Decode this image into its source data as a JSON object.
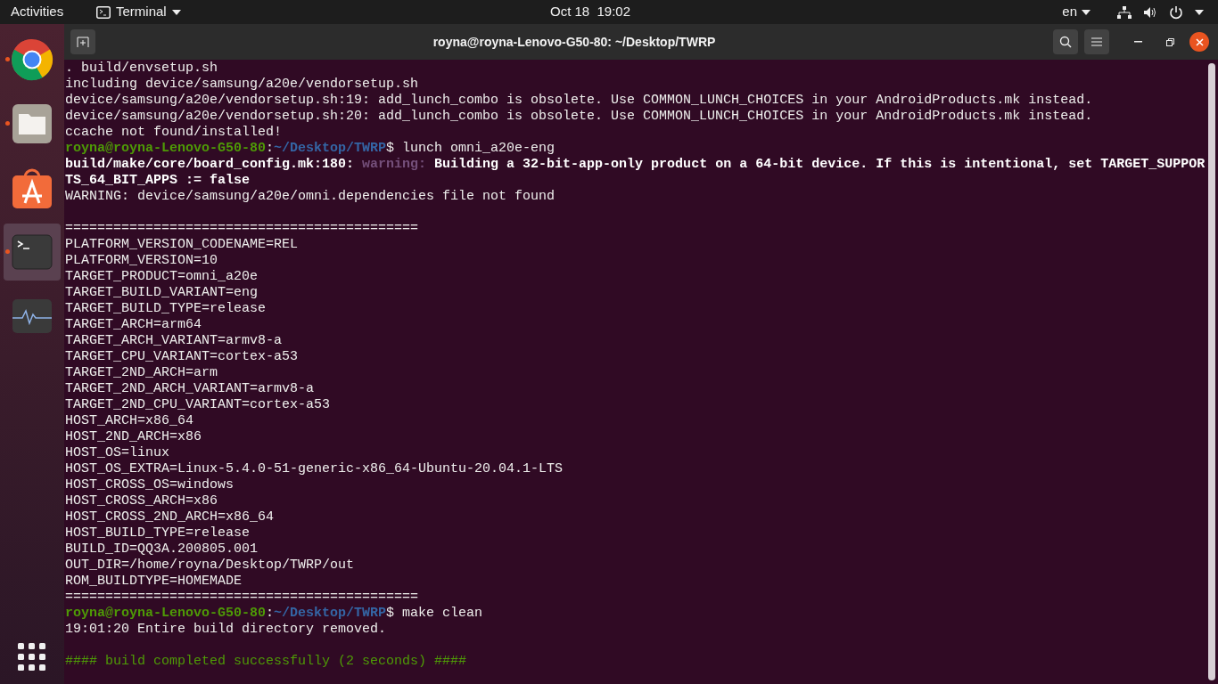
{
  "top_bar": {
    "activities": "Activities",
    "app_menu": "Terminal",
    "clock": "Oct 18  19:02",
    "language": "en"
  },
  "dock": {
    "items": [
      {
        "kind": "browser",
        "running": true,
        "selected": false
      },
      {
        "kind": "files",
        "running": true,
        "selected": false
      },
      {
        "kind": "store",
        "running": false,
        "selected": false
      },
      {
        "kind": "terminal",
        "running": true,
        "selected": true
      },
      {
        "kind": "monitor",
        "running": false,
        "selected": false
      }
    ]
  },
  "window": {
    "title": "royna@royna-Lenovo-G50-80: ~/Desktop/TWRP"
  },
  "terminal": {
    "lines": [
      {
        "kind": "text",
        "segments": [
          {
            "kind": "plain",
            "text": ". build/envsetup.sh"
          }
        ]
      },
      {
        "kind": "text",
        "segments": [
          {
            "kind": "plain",
            "text": "including device/samsung/a20e/vendorsetup.sh"
          }
        ]
      },
      {
        "kind": "text",
        "segments": [
          {
            "kind": "plain",
            "text": "device/samsung/a20e/vendorsetup.sh:19: add_lunch_combo is obsolete. Use COMMON_LUNCH_CHOICES in your AndroidProducts.mk instead."
          }
        ]
      },
      {
        "kind": "text",
        "segments": [
          {
            "kind": "plain",
            "text": "device/samsung/a20e/vendorsetup.sh:20: add_lunch_combo is obsolete. Use COMMON_LUNCH_CHOICES in your AndroidProducts.mk instead."
          }
        ]
      },
      {
        "kind": "text",
        "segments": [
          {
            "kind": "plain",
            "text": "ccache not found/installed!"
          }
        ]
      },
      {
        "kind": "text",
        "segments": [
          {
            "kind": "user",
            "text": "royna@royna-Lenovo-G50-80"
          },
          {
            "kind": "plain",
            "text": ":"
          },
          {
            "kind": "path",
            "text": "~/Desktop/TWRP"
          },
          {
            "kind": "plain",
            "text": "$ lunch omni_a20e-eng"
          }
        ]
      },
      {
        "kind": "text",
        "segments": [
          {
            "kind": "bold",
            "text": "build/make/core/board_config.mk:180: "
          },
          {
            "kind": "warning",
            "text": "warning: "
          },
          {
            "kind": "bold",
            "text": "Building a 32-bit-app-only product on a 64-bit device. If this is intentional, set TARGET_SUPPOR"
          }
        ]
      },
      {
        "kind": "text",
        "segments": [
          {
            "kind": "bold",
            "text": "TS_64_BIT_APPS := false"
          }
        ]
      },
      {
        "kind": "text",
        "segments": [
          {
            "kind": "plain",
            "text": "WARNING: device/samsung/a20e/omni.dependencies file not found"
          }
        ]
      },
      {
        "kind": "blank"
      },
      {
        "kind": "text",
        "segments": [
          {
            "kind": "plain",
            "text": "============================================"
          }
        ]
      },
      {
        "kind": "text",
        "segments": [
          {
            "kind": "plain",
            "text": "PLATFORM_VERSION_CODENAME=REL"
          }
        ]
      },
      {
        "kind": "text",
        "segments": [
          {
            "kind": "plain",
            "text": "PLATFORM_VERSION=10"
          }
        ]
      },
      {
        "kind": "text",
        "segments": [
          {
            "kind": "plain",
            "text": "TARGET_PRODUCT=omni_a20e"
          }
        ]
      },
      {
        "kind": "text",
        "segments": [
          {
            "kind": "plain",
            "text": "TARGET_BUILD_VARIANT=eng"
          }
        ]
      },
      {
        "kind": "text",
        "segments": [
          {
            "kind": "plain",
            "text": "TARGET_BUILD_TYPE=release"
          }
        ]
      },
      {
        "kind": "text",
        "segments": [
          {
            "kind": "plain",
            "text": "TARGET_ARCH=arm64"
          }
        ]
      },
      {
        "kind": "text",
        "segments": [
          {
            "kind": "plain",
            "text": "TARGET_ARCH_VARIANT=armv8-a"
          }
        ]
      },
      {
        "kind": "text",
        "segments": [
          {
            "kind": "plain",
            "text": "TARGET_CPU_VARIANT=cortex-a53"
          }
        ]
      },
      {
        "kind": "text",
        "segments": [
          {
            "kind": "plain",
            "text": "TARGET_2ND_ARCH=arm"
          }
        ]
      },
      {
        "kind": "text",
        "segments": [
          {
            "kind": "plain",
            "text": "TARGET_2ND_ARCH_VARIANT=armv8-a"
          }
        ]
      },
      {
        "kind": "text",
        "segments": [
          {
            "kind": "plain",
            "text": "TARGET_2ND_CPU_VARIANT=cortex-a53"
          }
        ]
      },
      {
        "kind": "text",
        "segments": [
          {
            "kind": "plain",
            "text": "HOST_ARCH=x86_64"
          }
        ]
      },
      {
        "kind": "text",
        "segments": [
          {
            "kind": "plain",
            "text": "HOST_2ND_ARCH=x86"
          }
        ]
      },
      {
        "kind": "text",
        "segments": [
          {
            "kind": "plain",
            "text": "HOST_OS=linux"
          }
        ]
      },
      {
        "kind": "text",
        "segments": [
          {
            "kind": "plain",
            "text": "HOST_OS_EXTRA=Linux-5.4.0-51-generic-x86_64-Ubuntu-20.04.1-LTS"
          }
        ]
      },
      {
        "kind": "text",
        "segments": [
          {
            "kind": "plain",
            "text": "HOST_CROSS_OS=windows"
          }
        ]
      },
      {
        "kind": "text",
        "segments": [
          {
            "kind": "plain",
            "text": "HOST_CROSS_ARCH=x86"
          }
        ]
      },
      {
        "kind": "text",
        "segments": [
          {
            "kind": "plain",
            "text": "HOST_CROSS_2ND_ARCH=x86_64"
          }
        ]
      },
      {
        "kind": "text",
        "segments": [
          {
            "kind": "plain",
            "text": "HOST_BUILD_TYPE=release"
          }
        ]
      },
      {
        "kind": "text",
        "segments": [
          {
            "kind": "plain",
            "text": "BUILD_ID=QQ3A.200805.001"
          }
        ]
      },
      {
        "kind": "text",
        "segments": [
          {
            "kind": "plain",
            "text": "OUT_DIR=/home/royna/Desktop/TWRP/out"
          }
        ]
      },
      {
        "kind": "text",
        "segments": [
          {
            "kind": "plain",
            "text": "ROM_BUILDTYPE=HOMEMADE"
          }
        ]
      },
      {
        "kind": "text",
        "segments": [
          {
            "kind": "plain",
            "text": "============================================"
          }
        ]
      },
      {
        "kind": "text",
        "segments": [
          {
            "kind": "user",
            "text": "royna@royna-Lenovo-G50-80"
          },
          {
            "kind": "plain",
            "text": ":"
          },
          {
            "kind": "path",
            "text": "~/Desktop/TWRP"
          },
          {
            "kind": "plain",
            "text": "$ make clean"
          }
        ]
      },
      {
        "kind": "text",
        "segments": [
          {
            "kind": "plain",
            "text": "19:01:20 Entire build directory removed."
          }
        ]
      },
      {
        "kind": "blank"
      },
      {
        "kind": "text",
        "segments": [
          {
            "kind": "success",
            "text": "#### build completed successfully (2 seconds) ####"
          }
        ]
      }
    ]
  }
}
